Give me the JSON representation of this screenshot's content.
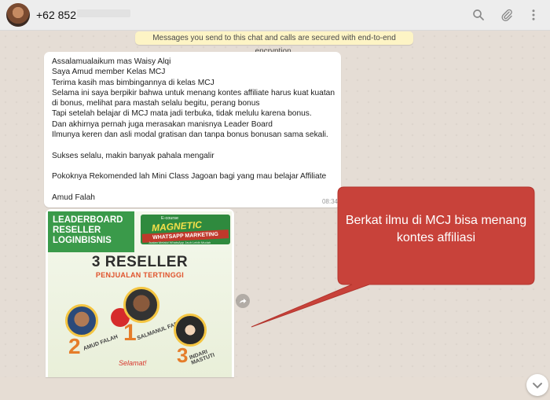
{
  "header": {
    "contact": "+62 852",
    "icons": [
      "search-icon",
      "paperclip-icon",
      "kebab-menu-icon"
    ]
  },
  "chat": {
    "encryption_notice": "Messages you send to this chat and calls are secured with end-to-end encryption.",
    "message": {
      "text": "Assalamualaikum mas Waisy Alqi\nSaya Amud member Kelas MCJ\nTerima kasih mas bimbingannya di kelas MCJ\nSelama ini saya berpikir bahwa untuk menang kontes affiliate harus kuat kuatan\ndi bonus, melihat para mastah selalu begitu, perang bonus\nTapi setelah belajar di MCJ mata jadi terbuka, tidak melulu karena bonus.\nDan akhirnya pernah juga merasakan manisnya Leader Board\nIlmunya keren dan asli modal gratisan dan tanpa bonus bonusan sama sekali.\n\nSukses selalu, makin banyak pahala mengalir\n\nPokoknya Rekomended lah Mini Class Jagoan bagi yang mau belajar Affiliate\n\nAmud Falah",
      "time": "08:34"
    },
    "poster": {
      "leaderboard": "LEADERBOARD\nRESELLER\nLOGINBISNIS",
      "ecourse_label": "E-course",
      "magnetic": "MAGNETIC",
      "whatsapp_marketing": "WHATSAPP MARKETING",
      "ecourse_tagline": "Jualan Melalui WhatsApp Jauh Lebih Mudah",
      "headline": "3 RESELLER",
      "subheadline": "PENJUALAN TERTINGGI",
      "ranks": [
        {
          "rank": "2",
          "name": "AMUD FALAH"
        },
        {
          "rank": "1",
          "name": "SALMANUL FARIS"
        },
        {
          "rank": "3",
          "name": "INDARI MASTUTI"
        }
      ],
      "selamat": "Selamat!"
    }
  },
  "callout": {
    "text": "Berkat ilmu di MCJ bisa menang kontes affiliasi",
    "color": "#c8423a"
  },
  "colors": {
    "header_bg": "#ededed",
    "chat_bg": "#e5ddd5",
    "notice_bg": "#fdf4c5",
    "poster_green": "#3a9a4a"
  }
}
